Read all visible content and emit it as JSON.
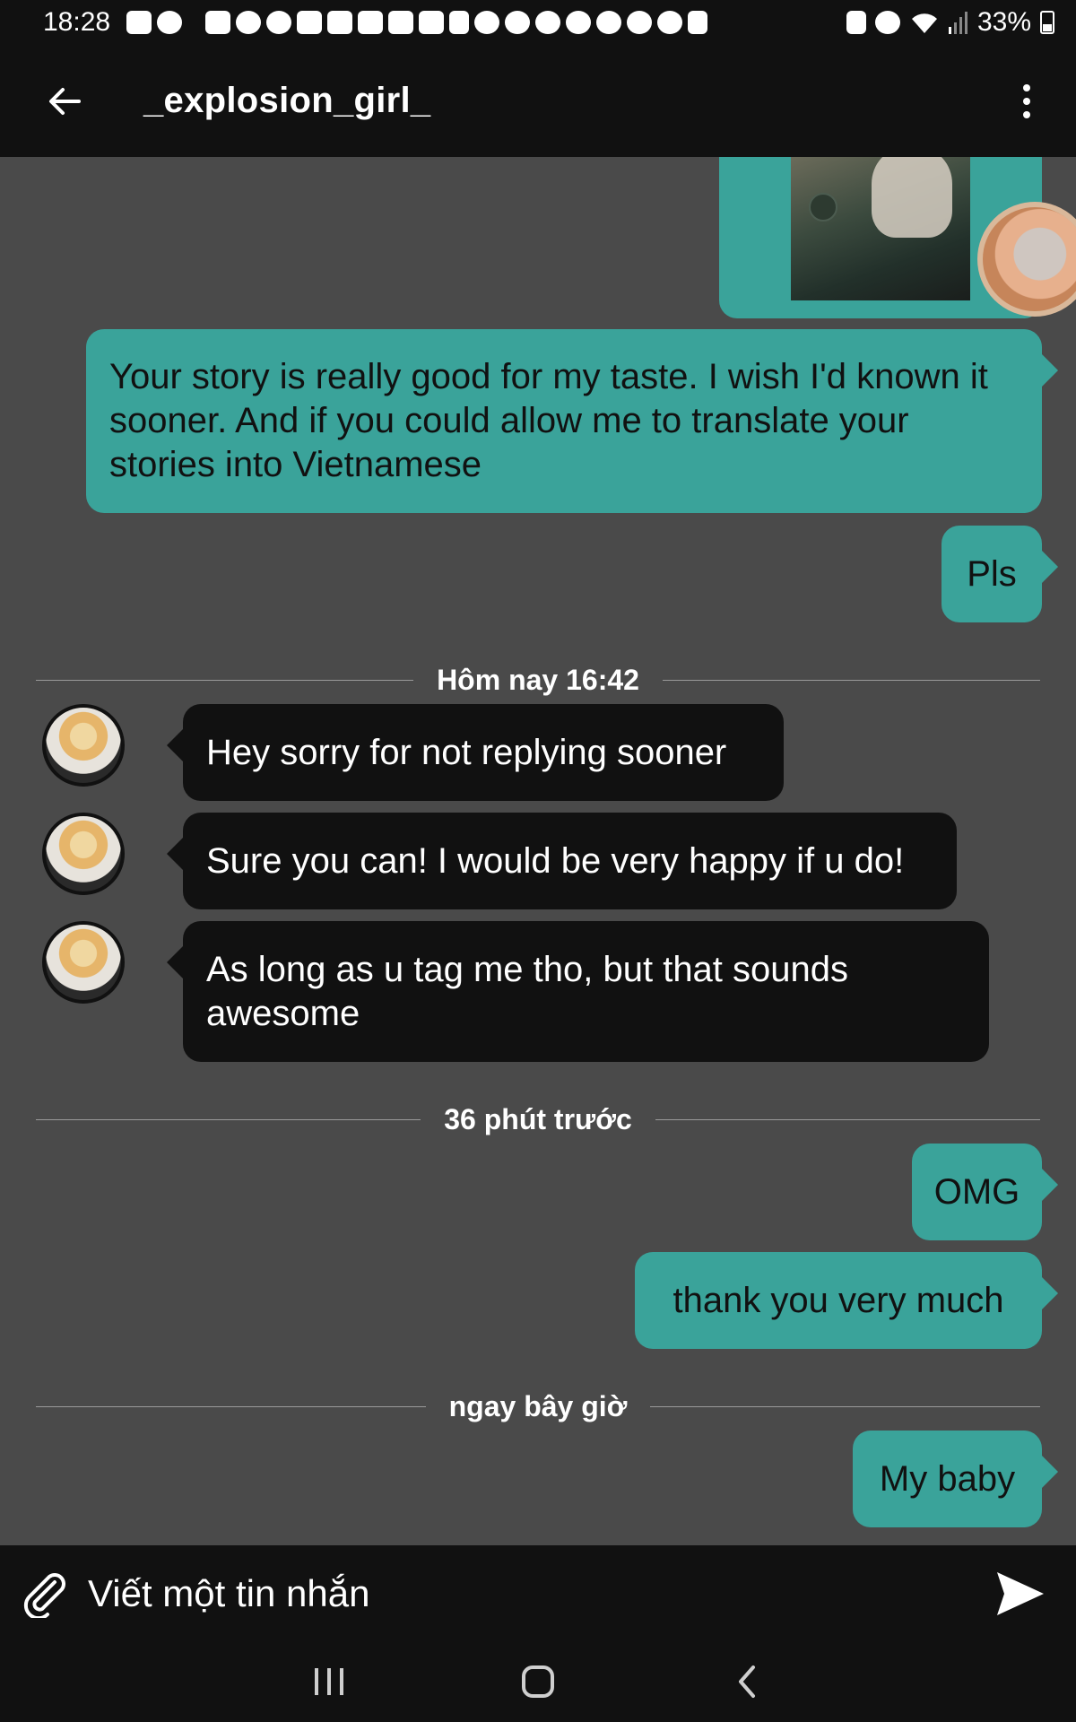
{
  "status_bar": {
    "time": "18:28",
    "battery": "33%",
    "notification_icons": [
      "zalo-icon",
      "messenger-icon",
      "zalo-icon",
      "pinterest-icon",
      "pinterest-icon",
      "youtube-icon",
      "youtube-icon",
      "youtube-icon",
      "youtube-icon",
      "youtube-icon",
      "keyhole-icon",
      "app-icon",
      "owl-icon",
      "leaf-icon",
      "owl-icon",
      "app-icon",
      "alarm-icon",
      "app-icon",
      "magnet-icon"
    ]
  },
  "header": {
    "title": "_explosion_girl_"
  },
  "messages": [
    {
      "type": "out",
      "text": "Your story is really good for my taste. I wish I'd known it sooner. And if you could allow me to translate your stories into Vietnamese"
    },
    {
      "type": "out",
      "text": "Pls"
    },
    {
      "type": "divider",
      "text": "Hôm nay 16:42"
    },
    {
      "type": "in",
      "text": "Hey sorry for not replying sooner"
    },
    {
      "type": "in",
      "text": "Sure you can! I would be very happy if u do!"
    },
    {
      "type": "in",
      "text": "As long as u tag me tho, but that sounds awesome"
    },
    {
      "type": "divider",
      "text": "36 phút trước"
    },
    {
      "type": "out",
      "text": "OMG"
    },
    {
      "type": "out",
      "text": "thank you very much"
    },
    {
      "type": "divider",
      "text": "ngay bây giờ"
    },
    {
      "type": "out",
      "text": "My baby"
    }
  ],
  "composer": {
    "placeholder": "Viết một tin nhắn"
  },
  "colors": {
    "outgoing_bubble": "#3aa39a",
    "incoming_bubble": "#111111",
    "chat_background": "#4a4a4a",
    "bars": "#111111"
  }
}
